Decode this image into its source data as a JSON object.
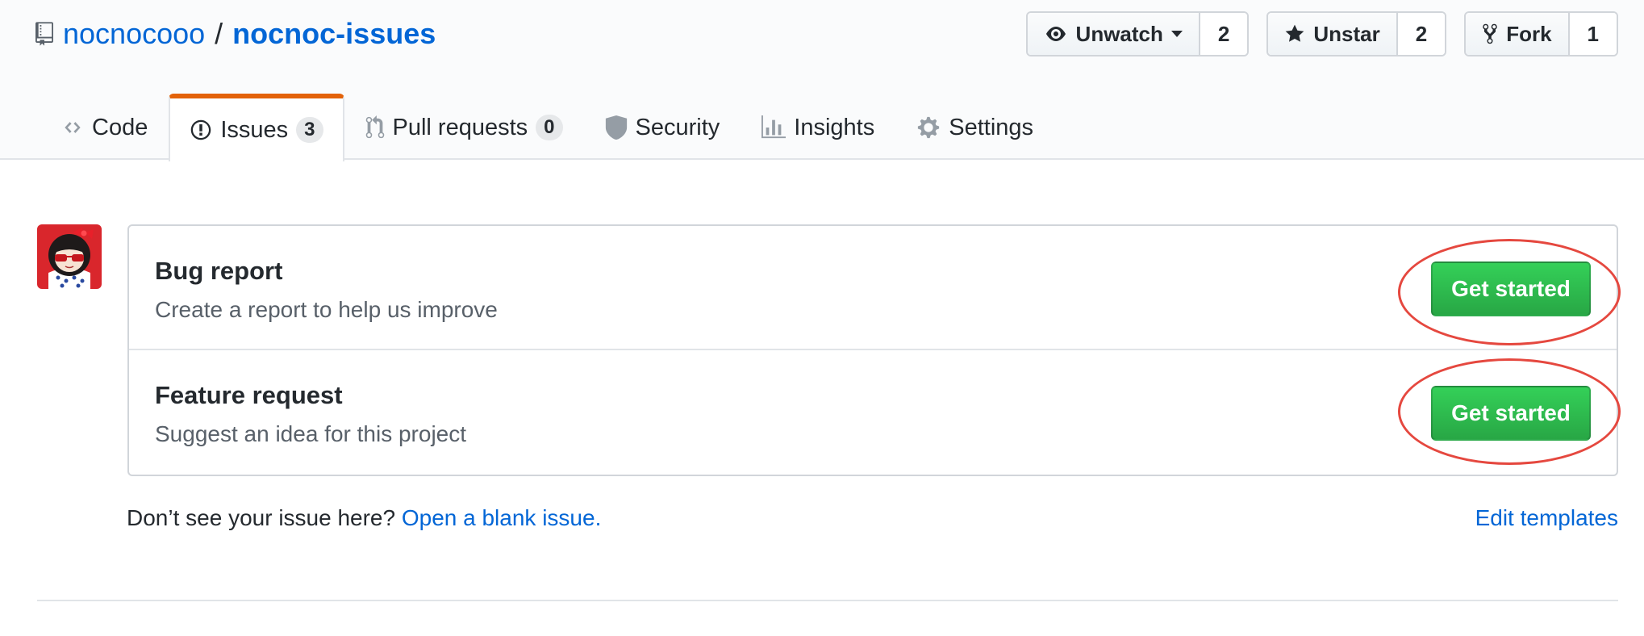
{
  "repo": {
    "owner": "nocnocooo",
    "separator": "/",
    "name": "nocnoc-issues"
  },
  "actions": {
    "watch": {
      "label": "Unwatch",
      "count": "2"
    },
    "star": {
      "label": "Unstar",
      "count": "2"
    },
    "fork": {
      "label": "Fork",
      "count": "1"
    }
  },
  "nav": {
    "code": "Code",
    "issues": {
      "label": "Issues",
      "count": "3"
    },
    "pulls": {
      "label": "Pull requests",
      "count": "0"
    },
    "security": "Security",
    "insights": "Insights",
    "settings": "Settings"
  },
  "templates": [
    {
      "title": "Bug report",
      "description": "Create a report to help us improve",
      "button": "Get started"
    },
    {
      "title": "Feature request",
      "description": "Suggest an idea for this project",
      "button": "Get started"
    }
  ],
  "footer": {
    "question": "Don’t see your issue here?",
    "blank_link": "Open a blank issue.",
    "edit_templates": "Edit templates"
  },
  "colors": {
    "link": "#0366d6",
    "primary_button": "#28a745",
    "selected_tab_accent": "#e36209",
    "annotation": "#e5483f"
  },
  "icons": {
    "repo": "repo-icon",
    "watch": "eye-icon",
    "star": "star-icon",
    "fork": "fork-icon",
    "code": "code-icon",
    "issues": "issue-opened-icon",
    "pulls": "git-pull-request-icon",
    "security": "shield-icon",
    "insights": "graph-icon",
    "settings": "gear-icon"
  }
}
